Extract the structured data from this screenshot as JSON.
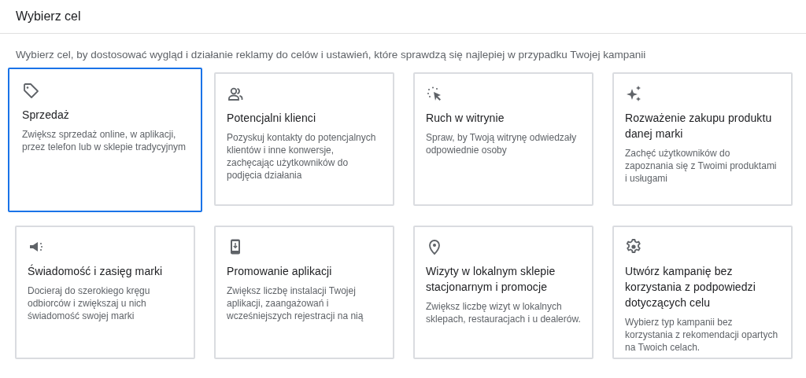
{
  "dialog": {
    "title": "Wybierz cel",
    "subtitle": "Wybierz cel, by dostosować wygląd i działanie reklamy do celów i ustawień, które sprawdzą się najlepiej w przypadku Twojej kampanii"
  },
  "goals": [
    {
      "kind": "tag",
      "title": "Sprzedaż",
      "description": "Zwiększ sprzedaż online, w aplikacji, przez telefon lub w sklepie tradycyjnym",
      "selected": true
    },
    {
      "kind": "people",
      "title": "Potencjalni klienci",
      "description": "Pozyskuj kontakty do potencjalnych klientów i inne konwersje, zachęcając użytkowników do podjęcia działania",
      "selected": false
    },
    {
      "kind": "cursor",
      "title": "Ruch w witrynie",
      "description": "Spraw, by Twoją witrynę odwiedzały odpowiednie osoby",
      "selected": false
    },
    {
      "kind": "sparkle",
      "title": "Rozważenie zakupu produktu danej marki",
      "description": "Zachęć użytkowników do zapoznania się z Twoimi produktami i usługami",
      "selected": false
    },
    {
      "kind": "speaker",
      "title": "Świadomość i zasięg marki",
      "description": "Docieraj do szerokiego kręgu odbiorców i zwiększaj u nich świadomość swojej marki",
      "selected": false
    },
    {
      "kind": "phone",
      "title": "Promowanie aplikacji",
      "description": "Zwiększ liczbę instalacji Twojej aplikacji, zaangażowań i wcześniejszych rejestracji na nią",
      "selected": false
    },
    {
      "kind": "pin",
      "title": "Wizyty w lokalnym sklepie stacjonarnym i promocje",
      "description": "Zwiększ liczbę wizyt w lokalnych sklepach, restauracjach i u dealerów.",
      "selected": false
    },
    {
      "kind": "gear",
      "title": "Utwórz kampanię bez korzystania z podpowiedzi dotyczących celu",
      "description": "Wybierz typ kampanii bez korzystania z rekomendacji opartych na Twoich celach.",
      "selected": false
    }
  ]
}
